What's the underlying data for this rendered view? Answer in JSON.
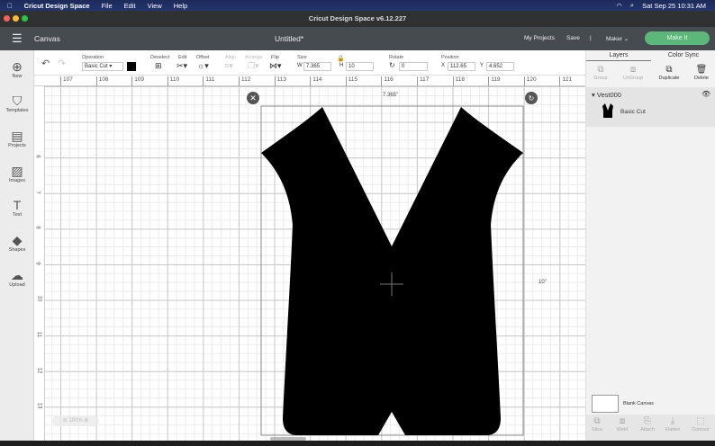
{
  "menubar": {
    "app": "Cricut Design Space",
    "items": [
      "File",
      "Edit",
      "View",
      "Help"
    ],
    "datetime": "Sat Sep 25  10:31 AM"
  },
  "window": {
    "title": "Cricut Design Space  v6.12.227"
  },
  "header": {
    "section": "Canvas",
    "doc_title": "Untitled*",
    "my_projects": "My Projects",
    "save": "Save",
    "separator": "|",
    "machine": "Maker",
    "make_it": "Make It"
  },
  "toolbar": {
    "operation_label": "Operation",
    "operation_value": "Basic Cut",
    "deselect": "Deselect",
    "edit": "Edit",
    "offset": "Offset",
    "align": "Align",
    "arrange": "Arrange",
    "flip": "Flip",
    "size": "Size",
    "w_label": "W",
    "w_value": "7.365",
    "h_label": "H",
    "h_value": "10",
    "rotate": "Rotate",
    "rotate_value": "0",
    "position": "Position",
    "x_label": "X",
    "x_value": "112.65",
    "y_label": "Y",
    "y_value": "4.652"
  },
  "sidebar": [
    {
      "label": "New",
      "icon": "⊕"
    },
    {
      "label": "Templates",
      "icon": "👕"
    },
    {
      "label": "Projects",
      "icon": "▤"
    },
    {
      "label": "Images",
      "icon": "🖼"
    },
    {
      "label": "Text",
      "icon": "T"
    },
    {
      "label": "Shapes",
      "icon": "◆"
    },
    {
      "label": "Upload",
      "icon": "☁"
    }
  ],
  "ruler": {
    "h": [
      "107",
      "108",
      "109",
      "110",
      "111",
      "112",
      "113",
      "114",
      "115",
      "116",
      "117",
      "118",
      "119",
      "120",
      "121"
    ],
    "v": [
      "6",
      "7",
      "8",
      "9",
      "10",
      "11",
      "12",
      "13"
    ]
  },
  "canvas": {
    "width_label": "7.365\"",
    "height_label": "10\"",
    "zoom": "100%"
  },
  "panel": {
    "tabs": [
      "Layers",
      "Color Sync"
    ],
    "actions": [
      "Group",
      "UnGroup",
      "Duplicate",
      "Delete"
    ],
    "layer_group": "Vest000",
    "layer_item": "Basic Cut",
    "blank_canvas": "Blank Canvas",
    "bottom_actions": [
      "Slice",
      "Weld",
      "Attach",
      "Flatten",
      "Contour"
    ]
  },
  "colors": {
    "accent": "#5cb87a",
    "header": "#464b4f"
  }
}
